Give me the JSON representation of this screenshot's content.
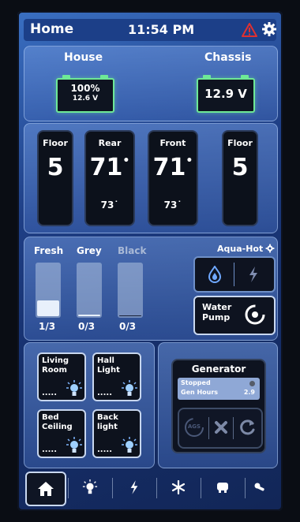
{
  "header": {
    "title": "Home",
    "time": "11:54 PM"
  },
  "batteries": {
    "house": {
      "label": "House",
      "percent": "100%",
      "voltage": "12.6 V"
    },
    "chassis": {
      "label": "Chassis",
      "voltage": "12.9 V"
    }
  },
  "climate": [
    {
      "label": "Floor",
      "value": "5"
    },
    {
      "label": "Rear",
      "value": "71",
      "setpoint": "73"
    },
    {
      "label": "Front",
      "value": "71",
      "setpoint": "73"
    },
    {
      "label": "Floor",
      "value": "5"
    }
  ],
  "tanks": [
    {
      "label": "Fresh",
      "level": "1/3",
      "fill": 0.33
    },
    {
      "label": "Grey",
      "level": "0/3",
      "fill": 0
    },
    {
      "label": "Black",
      "level": "0/3",
      "fill": 0
    }
  ],
  "aquahot": {
    "title": "Aqua-Hot"
  },
  "water_pump": {
    "label_line1": "Water",
    "label_line2": "Pump"
  },
  "lights": [
    {
      "line1": "Living",
      "line2": "Room",
      "dots": "....."
    },
    {
      "line1": "Hall",
      "line2": "Light",
      "dots": "....."
    },
    {
      "line1": "Bed",
      "line2": "Ceiling",
      "dots": "....."
    },
    {
      "line1": "Back",
      "line2": "light",
      "dots": "....."
    }
  ],
  "generator": {
    "title": "Generator",
    "status": "Stopped",
    "hours_label": "Gen Hours",
    "hours_value": "2.9",
    "ags_label": "AGS"
  },
  "colors": {
    "accent_green": "#6ee896",
    "alert_red": "#e03030"
  }
}
